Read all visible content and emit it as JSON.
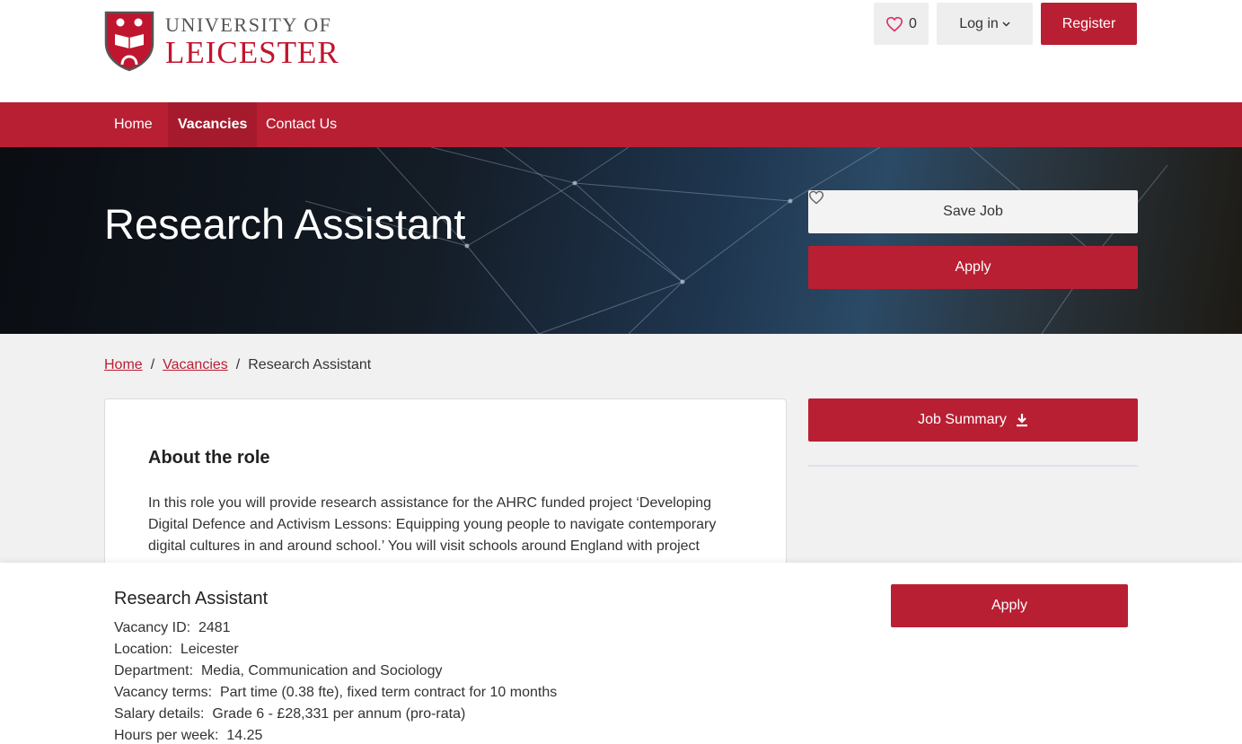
{
  "header": {
    "logo_line1": "UNIVERSITY OF",
    "logo_line2": "LEICESTER",
    "favourites_count": "0",
    "login_label": "Log in",
    "register_label": "Register"
  },
  "nav": {
    "items": [
      {
        "label": "Home"
      },
      {
        "label": "Vacancies"
      },
      {
        "label": "Contact Us"
      }
    ]
  },
  "hero": {
    "title": "Research Assistant",
    "save_job_label": "Save Job",
    "apply_label": "Apply"
  },
  "breadcrumb": {
    "items": [
      "Home",
      "Vacancies",
      "Research Assistant"
    ],
    "separator": "/"
  },
  "main": {
    "heading": "About the role",
    "body": "In this role you will provide research assistance for the AHRC funded project ‘Developing Digital Defence and Activism Lessons: Equipping young people to navigate contemporary digital cultures in and around school.’ You will visit schools around England with project"
  },
  "sidebar": {
    "job_summary_label": "Job Summary"
  },
  "sticky": {
    "title": "Research Assistant",
    "apply_label": "Apply",
    "details": [
      {
        "label": "Vacancy ID:",
        "value": "2481"
      },
      {
        "label": "Location:",
        "value": "Leicester"
      },
      {
        "label": "Department:",
        "value": "Media, Communication and Sociology"
      },
      {
        "label": "Vacancy terms:",
        "value": "Part time (0.38 fte), fixed term contract for 10 months"
      },
      {
        "label": "Salary details:",
        "value": "Grade 6 - £28,331 per annum (pro-rata)"
      },
      {
        "label": "Hours per week:",
        "value": "14.25"
      }
    ]
  },
  "colors": {
    "brand": "#b91f33",
    "nav_active": "#a51b2d"
  }
}
